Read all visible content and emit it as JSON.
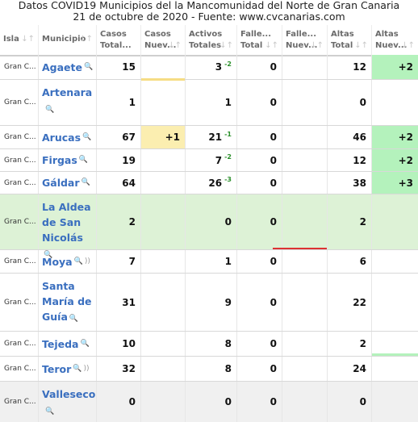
{
  "title": {
    "line1": "Datos COVID19 Municipios del la Mancomunidad del Norte de Gran Canaria",
    "line2": "21 de octubre de 2020 - Fuente: www.cvcanarias.com"
  },
  "headers": {
    "isla": "Isla",
    "municipio": "Municipio",
    "casos_total": [
      "Casos",
      "Total..."
    ],
    "casos_nuevos": [
      "Casos",
      "Nuev..."
    ],
    "activos": [
      "Activos",
      "Totales"
    ],
    "fallecidos_total": [
      "Falle...",
      "Total"
    ],
    "fallecidos_nuevos": [
      "Falle...",
      "Nuev..."
    ],
    "altas_total": [
      "Altas",
      "Total"
    ],
    "altas_nuevas": [
      "Altas",
      "Nuev..."
    ]
  },
  "rows": [
    {
      "isla": "Gran C...",
      "municipio": "Agaete",
      "casos": "15",
      "casos_nuevos": "",
      "activos": "3",
      "activos_delta": "-2",
      "fallecidos": "0",
      "fallecidos_nuevos": "",
      "altas": "12",
      "altas_nuevas": "+2"
    },
    {
      "isla": "Gran C...",
      "municipio": "Artenara",
      "casos": "1",
      "casos_nuevos": "",
      "activos": "1",
      "activos_delta": "",
      "fallecidos": "0",
      "fallecidos_nuevos": "",
      "altas": "0",
      "altas_nuevas": ""
    },
    {
      "isla": "Gran C...",
      "municipio": "Arucas",
      "casos": "67",
      "casos_nuevos": "+1",
      "activos": "21",
      "activos_delta": "-1",
      "fallecidos": "0",
      "fallecidos_nuevos": "",
      "altas": "46",
      "altas_nuevas": "+2"
    },
    {
      "isla": "Gran C...",
      "municipio": "Firgas",
      "casos": "19",
      "casos_nuevos": "",
      "activos": "7",
      "activos_delta": "-2",
      "fallecidos": "0",
      "fallecidos_nuevos": "",
      "altas": "12",
      "altas_nuevas": "+2"
    },
    {
      "isla": "Gran C...",
      "municipio": "Gáldar",
      "casos": "64",
      "casos_nuevos": "",
      "activos": "26",
      "activos_delta": "-3",
      "fallecidos": "0",
      "fallecidos_nuevos": "",
      "altas": "38",
      "altas_nuevas": "+3"
    },
    {
      "isla": "Gran C...",
      "municipio_lines": [
        "La Aldea",
        "de San",
        "Nicolás"
      ],
      "casos": "2",
      "casos_nuevos": "",
      "activos": "0",
      "activos_delta": "",
      "fallecidos": "0",
      "fallecidos_nuevos": "",
      "altas": "2",
      "altas_nuevas": ""
    },
    {
      "isla": "Gran C...",
      "municipio": "Moya",
      "casos": "7",
      "casos_nuevos": "",
      "activos": "1",
      "activos_delta": "",
      "fallecidos": "0",
      "fallecidos_nuevos": "",
      "altas": "6",
      "altas_nuevas": ""
    },
    {
      "isla": "Gran C...",
      "municipio_lines": [
        "Santa",
        "María de",
        "Guía"
      ],
      "casos": "31",
      "casos_nuevos": "",
      "activos": "9",
      "activos_delta": "",
      "fallecidos": "0",
      "fallecidos_nuevos": "",
      "altas": "22",
      "altas_nuevas": ""
    },
    {
      "isla": "Gran C...",
      "municipio": "Tejeda",
      "casos": "10",
      "casos_nuevos": "",
      "activos": "8",
      "activos_delta": "",
      "fallecidos": "0",
      "fallecidos_nuevos": "",
      "altas": "2",
      "altas_nuevas": ""
    },
    {
      "isla": "Gran C...",
      "municipio": "Teror",
      "casos": "32",
      "casos_nuevos": "",
      "activos": "8",
      "activos_delta": "",
      "fallecidos": "0",
      "fallecidos_nuevos": "",
      "altas": "24",
      "altas_nuevas": ""
    },
    {
      "isla": "Gran C...",
      "municipio": "Valleseco",
      "casos": "0",
      "casos_nuevos": "",
      "activos": "0",
      "activos_delta": "",
      "fallecidos": "0",
      "fallecidos_nuevos": "",
      "altas": "0",
      "altas_nuevas": ""
    }
  ],
  "icons": {
    "sort": "sort-arrows-icon",
    "search": "magnifier-icon",
    "rss": "rss-feed-icon"
  },
  "colors": {
    "link": "#3a6fbf",
    "new_cases": "#fbeeb0",
    "new_discharges": "#b4f2bc",
    "highlight_row": "#ddf2d6",
    "delta_text": "#2a8f2a",
    "header_text": "#6b6b6b"
  }
}
